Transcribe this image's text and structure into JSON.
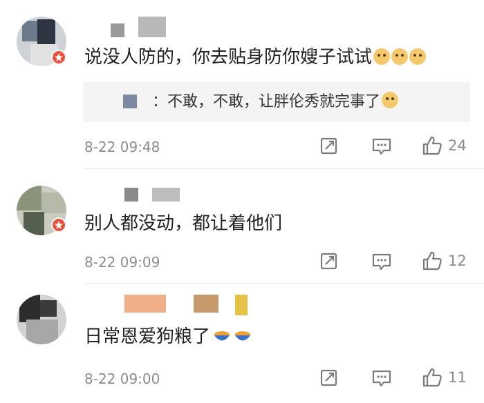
{
  "comments": [
    {
      "text": "说没人防的，你去贴身防你嫂子试试",
      "reply": {
        "text": "：不敢，不敢，让胖伦秀就完事了"
      },
      "time": "8-22 09:48",
      "likes": "24"
    },
    {
      "text": "别人都没动，都让着他们",
      "time": "8-22 09:09",
      "likes": "12"
    },
    {
      "text": "日常恩爱狗粮了",
      "time": "8-22 09:00",
      "likes": "11"
    }
  ],
  "icons": {
    "emoji_doge": "doge-emoji-icon",
    "emoji_bowl": "dog-food-bowl-emoji-icon",
    "repost": "repost-icon",
    "reply": "reply-comment-icon",
    "like": "thumbs-up-icon",
    "badge": "verified-badge-icon"
  },
  "colors": {
    "badge": "#e8533f",
    "meta": "#8c8c8c",
    "reply_bg": "#f4f4f4"
  }
}
